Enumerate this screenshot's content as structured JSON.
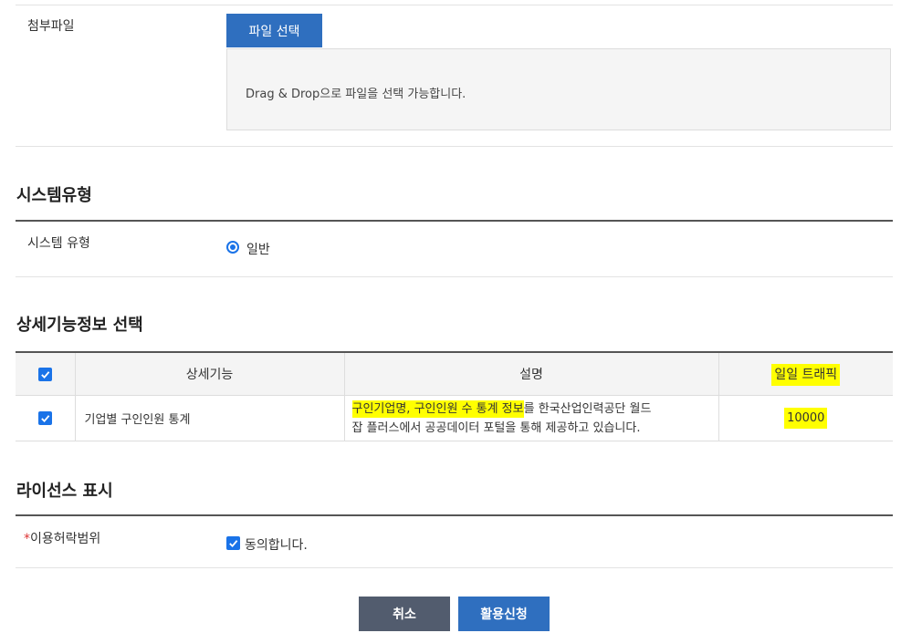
{
  "attachment": {
    "label": "첨부파일",
    "file_button": "파일 선택",
    "drop_hint": "Drag & Drop으로 파일을 선택 가능합니다."
  },
  "system_type": {
    "section_title": "시스템유형",
    "label": "시스템 유형",
    "option": "일반",
    "selected": true
  },
  "detail_function": {
    "section_title": "상세기능정보 선택",
    "headers": {
      "function": "상세기능",
      "description": "설명",
      "traffic": "일일 트래픽"
    },
    "rows": [
      {
        "checked": true,
        "function": "기업별 구인인원 통계",
        "description_highlight": "구인기업명, 구인인원 수 통계 정보",
        "description_rest_line1": "를 한국산업인력공단 월드",
        "description_line2": "잡 플러스에서 공공데이터 포털을 통해 제공하고 있습니다.",
        "traffic": "10000"
      }
    ]
  },
  "license": {
    "section_title": "라이선스 표시",
    "required_mark": "*",
    "label": "이용허락범위",
    "agree_text": "동의합니다.",
    "agreed": true
  },
  "buttons": {
    "cancel": "취소",
    "apply": "활용신청"
  },
  "colors": {
    "primary": "#2f6fbf",
    "cancel": "#525c6e",
    "highlight": "#ffff00",
    "check": "#1a73e8"
  }
}
